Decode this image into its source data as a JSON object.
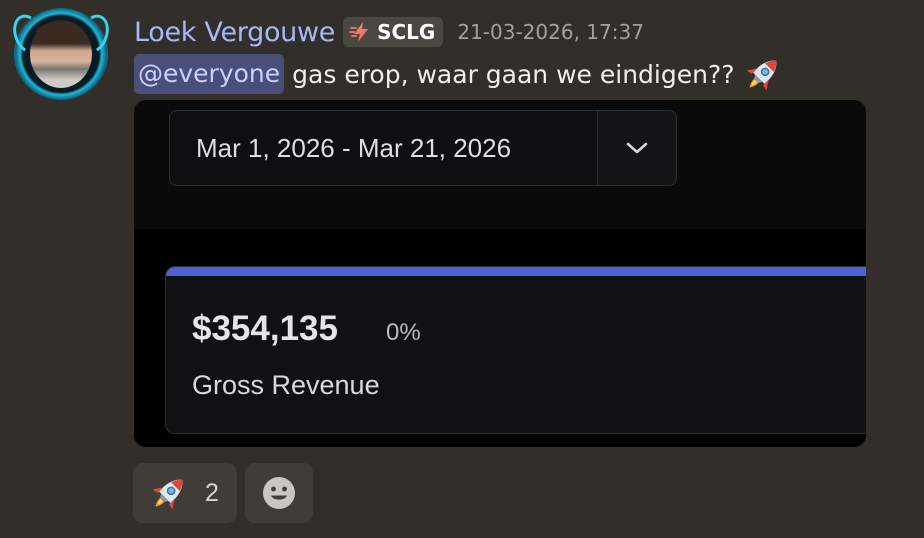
{
  "message": {
    "author": "Loek Vergouwe",
    "guild_tag": {
      "label": "SCLG",
      "icon": "lightning-bolt-icon"
    },
    "timestamp": "21-03-2026, 17:37",
    "mention": "@everyone",
    "text": "gas erop, waar gaan we eindigen??",
    "emoji": "rocket-emoji"
  },
  "embed": {
    "date_range": "Mar 1, 2026 - Mar 21, 2026",
    "dropdown_icon": "chevron-down-icon",
    "metric": {
      "value": "$354,135",
      "change": "0%",
      "label": "Gross Revenue"
    }
  },
  "reactions": [
    {
      "emoji": "rocket-emoji",
      "count": "2"
    }
  ],
  "add_reaction_icon": "smiley-icon",
  "colors": {
    "background": "#322e29",
    "username": "#a9b6f7",
    "mention_bg": "#4a4f7a",
    "accent_bar": "#5061d6"
  }
}
